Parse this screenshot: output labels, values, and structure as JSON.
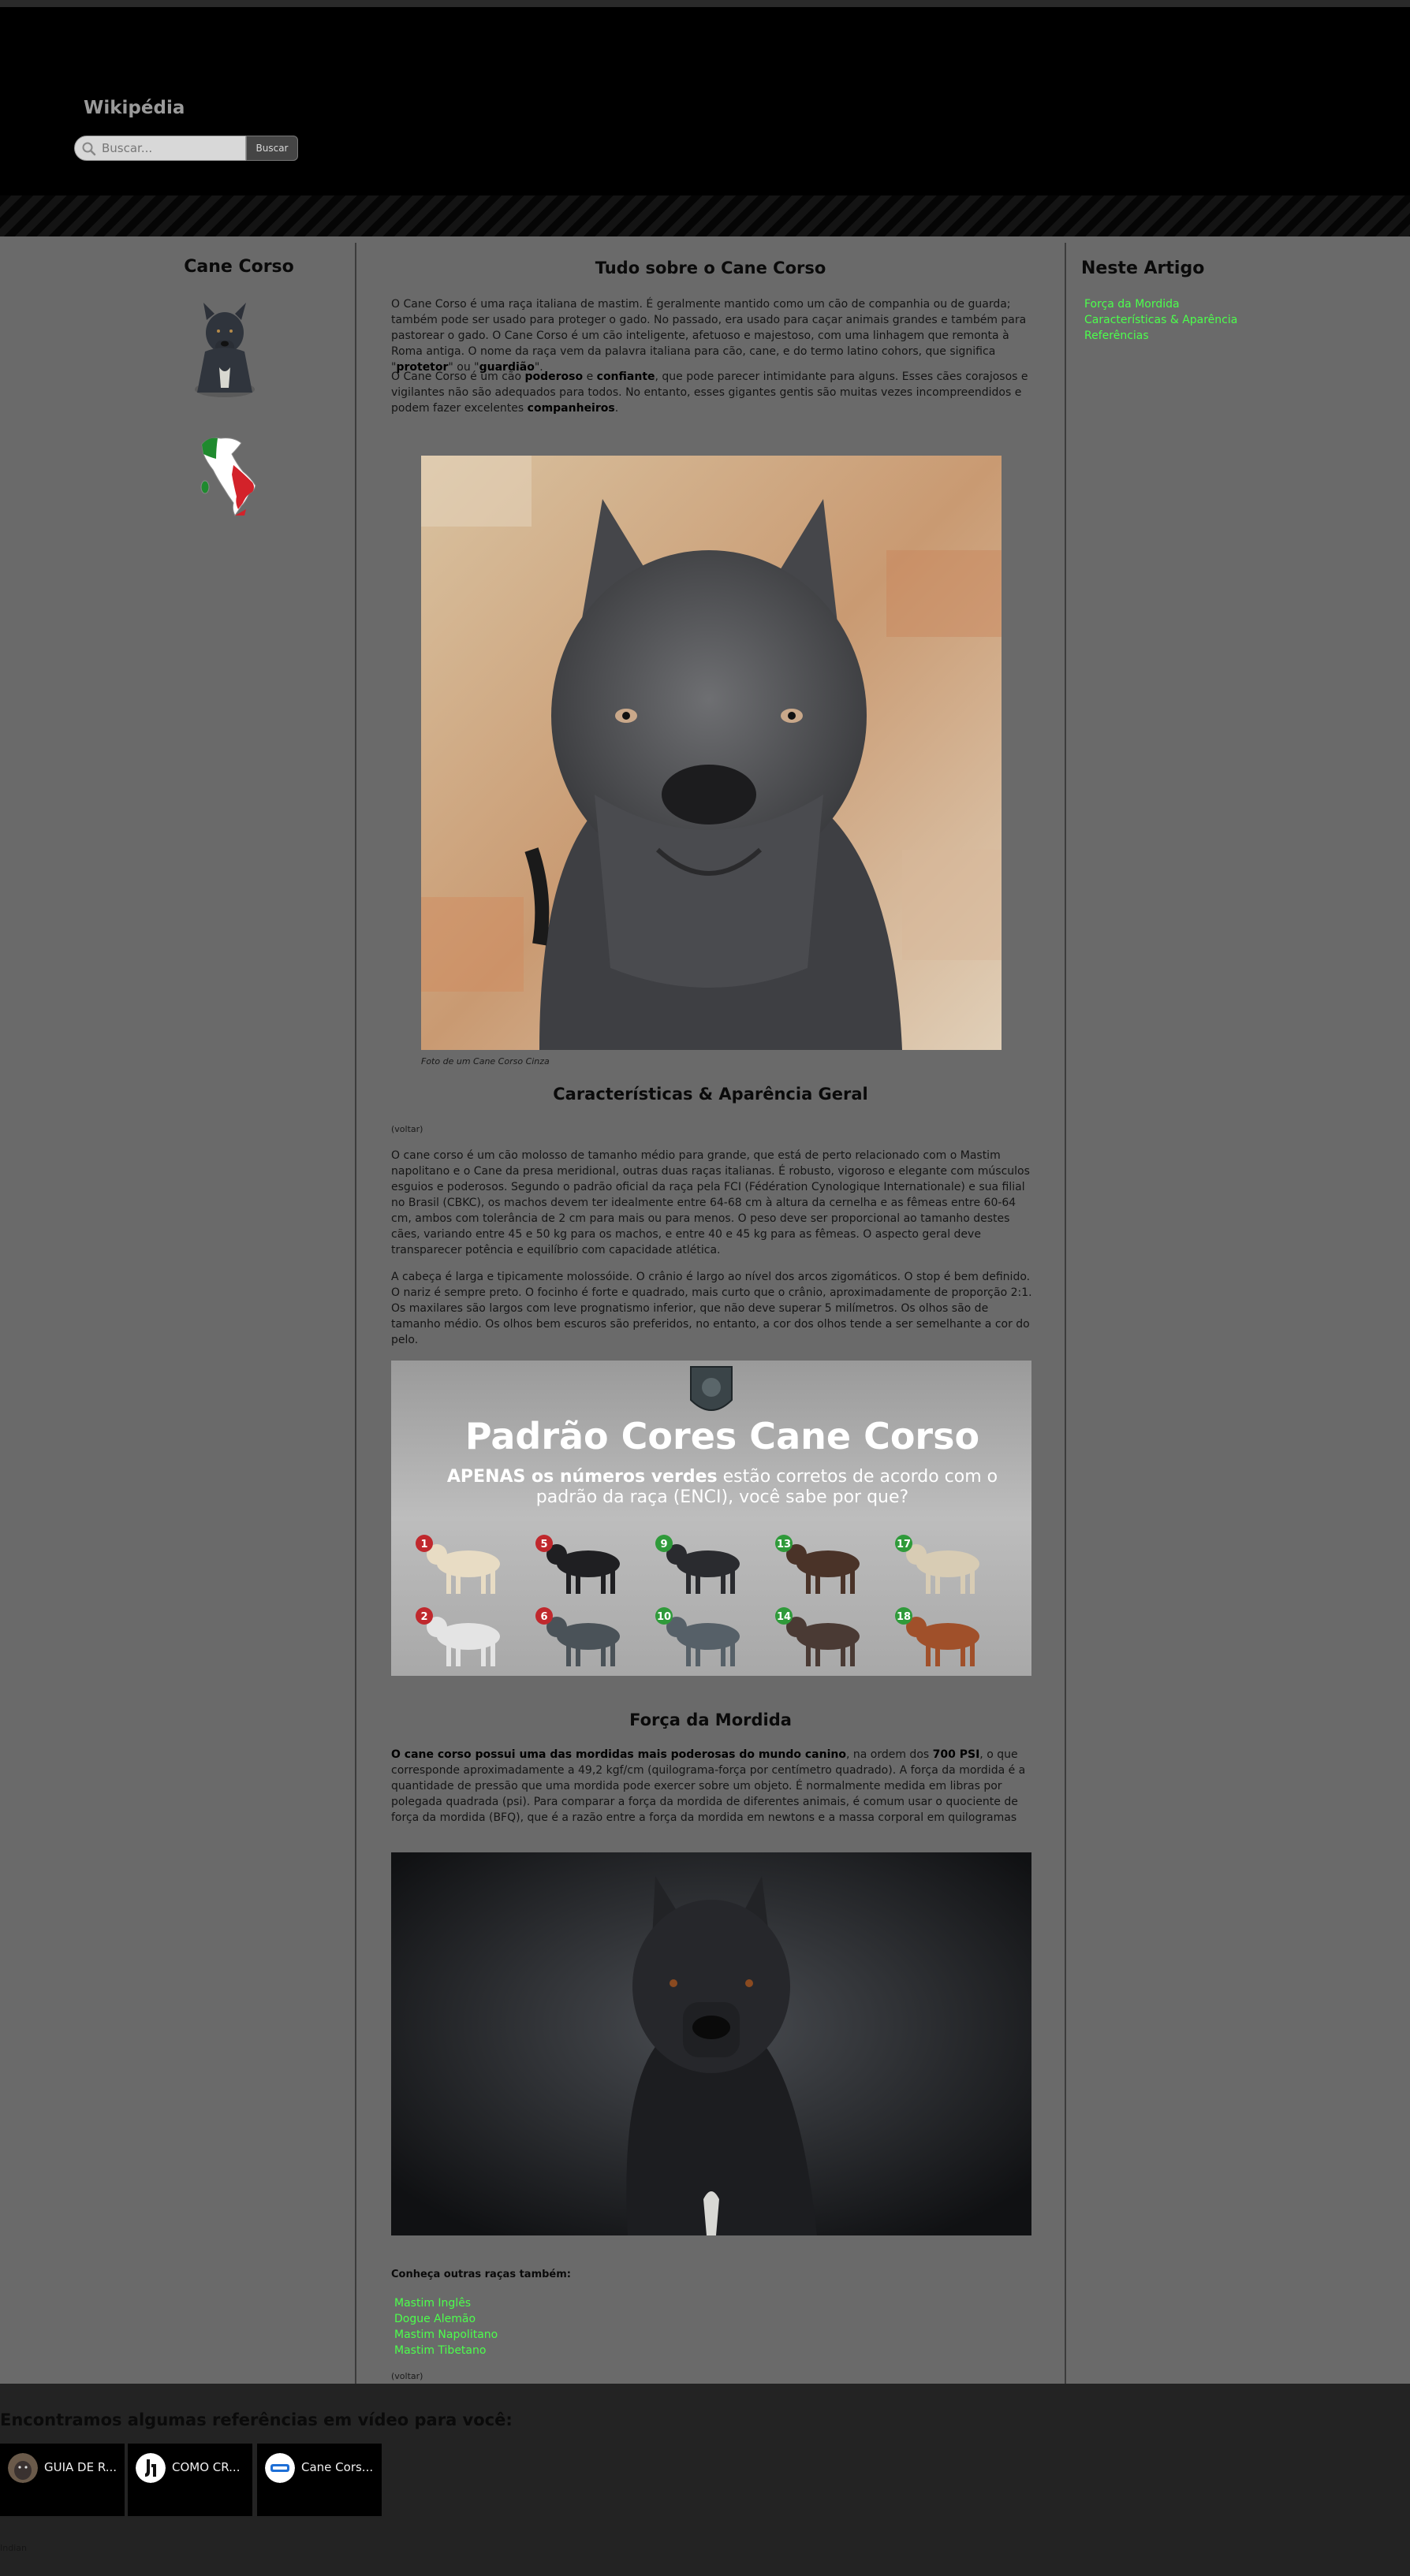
{
  "header": {
    "site_title": "Wikipédia",
    "search_placeholder": "Buscar...",
    "search_button": "Buscar"
  },
  "sidebar": {
    "title": "Cane Corso"
  },
  "toc": {
    "title": "Neste Artigo",
    "items": [
      "Força da Mordida",
      "Características & Aparência",
      "Referências"
    ]
  },
  "main": {
    "title": "Tudo sobre o Cane Corso",
    "intro_p1_a": "O Cane Corso é uma raça italiana de mastim. É geralmente mantido como um cão de companhia ou de guarda; também pode ser usado para proteger o gado. No passado, era usado para caçar animais grandes e também para pastorear o gado. O Cane Corso é um cão inteligente, afetuoso e majestoso, com uma linhagem que remonta à Roma antiga. O nome da raça vem da palavra italiana para cão, cane, e do termo latino cohors, que significa \"",
    "intro_p1_b1": "protetor",
    "intro_p1_c": "\" ou \"",
    "intro_p1_b2": "guardião",
    "intro_p1_d": "\".",
    "intro_p2_a": "O Cane Corso é um cão ",
    "intro_p2_b1": "poderoso",
    "intro_p2_c": " e ",
    "intro_p2_b2": "confiante",
    "intro_p2_d": ", que pode parecer intimidante para alguns. Esses cães corajosos e vigilantes não são adequados para todos. No entanto, esses gigantes gentis são muitas vezes incompreendidos e podem fazer excelentes ",
    "intro_p2_b3": "companheiros",
    "intro_p2_e": ".",
    "photo1_caption": "Foto de um Cane Corso Cinza",
    "section1_title": "Características & Aparência Geral",
    "voltar": "(voltar)",
    "section1_p1": "O cane corso é um cão molosso de tamanho médio para grande, que está de perto relacionado com o Mastim napolitano e o Cane da presa meridional, outras duas raças italianas. É robusto, vigoroso e elegante com músculos esguios e poderosos. Segundo o padrão oficial da raça pela FCI (Fédération Cynologique Internationale) e sua filial no Brasil (CBKC), os machos devem ter idealmente entre 64-68 cm à altura da cernelha e as fêmeas entre 60-64 cm, ambos com tolerância de 2 cm para mais ou para menos. O peso deve ser proporcional ao tamanho destes cães, variando entre 45 e 50 kg para os machos, e entre 40 e 45 kg para as fêmeas. O aspecto geral deve transparecer potência e equilíbrio com capacidade atlética.",
    "section1_p2": "A cabeça é larga e tipicamente molossóide. O crânio é largo ao nível dos arcos zigomáticos. O stop é bem definido. O nariz é sempre preto. O focinho é forte e quadrado, mais curto que o crânio, aproximadamente de proporção 2:1. Os maxilares são largos com leve prognatismo inferior, que não deve superar 5 milímetros. Os olhos são de tamanho médio. Os olhos bem escuros são preferidos, no entanto, a cor dos olhos tende a ser semelhante a cor do pelo.",
    "infographic": {
      "title": "Padrão Cores Cane Corso",
      "sub_a": "APENAS os ",
      "sub_b": "números verdes",
      "sub_c": " estão corretos de acordo com o",
      "sub_line2": "padrão da raça (ENCI), você sabe por que?",
      "numbers_row1": [
        "1",
        "5",
        "9",
        "13",
        "17"
      ],
      "numbers_row2": [
        "2",
        "6",
        "10",
        "14",
        "18"
      ],
      "badge_colors_row1": [
        "#c0282d",
        "#c0282d",
        "#2f9a3a",
        "#2f9a3a",
        "#2f9a3a"
      ],
      "badge_colors_row2": [
        "#c0282d",
        "#c0282d",
        "#2f9a3a",
        "#2f9a3a",
        "#2f9a3a"
      ]
    },
    "section2_title": "Força da Mordida",
    "section2_b1": "O cane corso possui uma das mordidas mais poderosas do mundo canino",
    "section2_a": ", na ordem dos ",
    "section2_b2": "700 PSI",
    "section2_c": ", o que corresponde aproximadamente a 49,2 kgf/cm (quilograma-força por centímetro quadrado). A força da mordida é a quantidade de pressão que uma mordida pode exercer sobre um objeto. É normalmente medida em libras por polegada quadrada (psi). Para comparar a força da mordida de diferentes animais, é comum usar o quociente de força da mordida (BFQ), que é a razão entre a força da mordida em newtons e a massa corporal em quilogramas",
    "others_title": "Conheça outras raças também:",
    "others": [
      "Mastim Inglês",
      "Dogue Alemão",
      "Mastim Napolitano",
      "Mastim Tibetano"
    ]
  },
  "footer": {
    "video_title": "Encontramos algumas referências em vídeo para você:",
    "videos": [
      {
        "label": "GUIA DE R...",
        "thumb": "dog-avatar"
      },
      {
        "label": "COMO CR...",
        "thumb": "logo-avatar"
      },
      {
        "label": "Cane Cors...",
        "thumb": "blue-avatar"
      }
    ],
    "note": "Indian"
  },
  "colors": {
    "link": "#4cff4c",
    "body_bg": "#6a6a6a",
    "footer_bg": "#232323"
  }
}
